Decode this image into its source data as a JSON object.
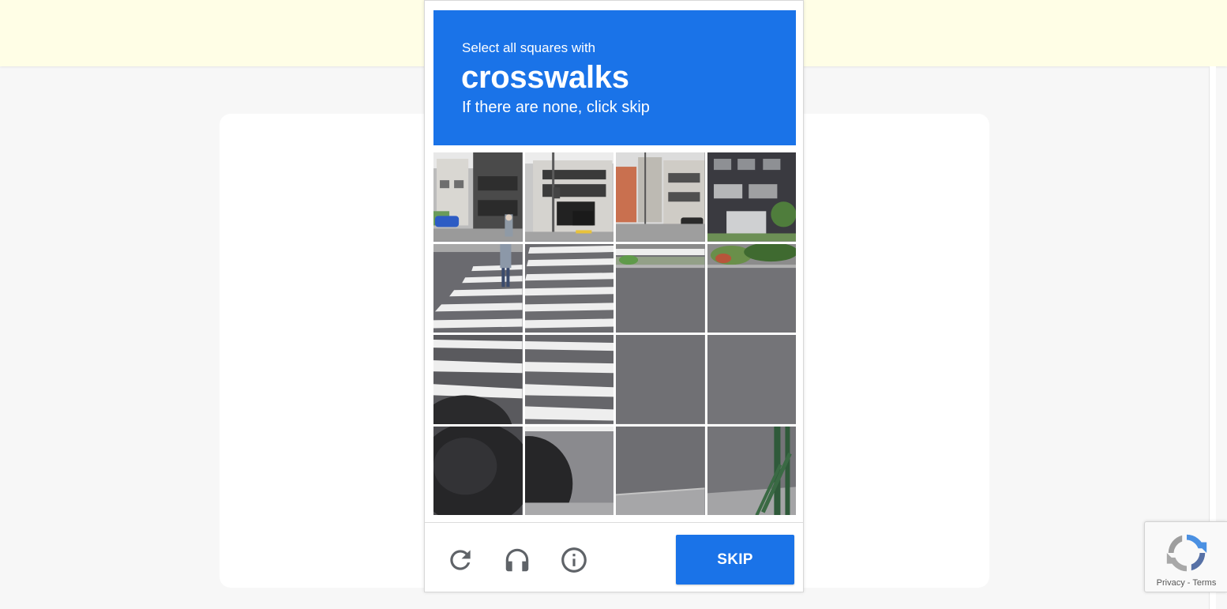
{
  "challenge": {
    "instruction_line1": "Select all squares with",
    "keyword": "crosswalks",
    "instruction_line3": "If there are none, click skip"
  },
  "grid": {
    "rows": 4,
    "columns": 4
  },
  "controls": {
    "reload_icon": "reload-icon",
    "audio_icon": "headphones-icon",
    "info_icon": "info-icon",
    "skip_label": "SKIP"
  },
  "badge": {
    "privacy_label": "Privacy",
    "separator": "-",
    "terms_label": "Terms"
  },
  "colors": {
    "accent": "#1a73e8",
    "banner": "#fffee6",
    "page_background": "#f7f7f7"
  }
}
